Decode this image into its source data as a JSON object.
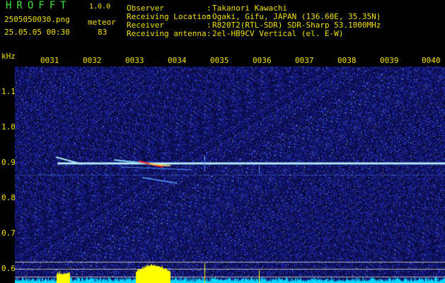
{
  "header": {
    "title": "HROFFT",
    "version": "1.0.0",
    "file_name": "2505050030.png",
    "datetime": "25.05.05 00:30",
    "meteor_label": "meteor",
    "meteor_count": "83"
  },
  "info": [
    {
      "label": "Observer",
      "value": "Takanori Kawachi"
    },
    {
      "label": "Receiving Location",
      "value": "Ogaki, Gifu, JAPAN (136.60E, 35.35N)"
    },
    {
      "label": "Receiver",
      "value": "R820T2(RTL-SDR) SDR-Sharp 53.1000MHz"
    },
    {
      "label": "Receiving antenna",
      "value": "2el-HB9CV Vertical (el. E-W)"
    }
  ],
  "axis": {
    "unit_label": "kHz",
    "time_ticks": [
      "0031",
      "0032",
      "0033",
      "0034",
      "0035",
      "0036",
      "0037",
      "0038",
      "0039",
      "0040"
    ],
    "freq_ticks": [
      "1.1",
      "1.0",
      "0.9",
      "0.8",
      "0.7",
      "0.6"
    ]
  },
  "colors": {
    "text": "#f0e000",
    "title": "#39e639",
    "background": "#0a0a3c",
    "carrier": "#c8f0ff",
    "echo_hot": "#ff3020",
    "spectrum_fill": "#00d8ff",
    "spectrum_peak": "#ffff00"
  }
}
